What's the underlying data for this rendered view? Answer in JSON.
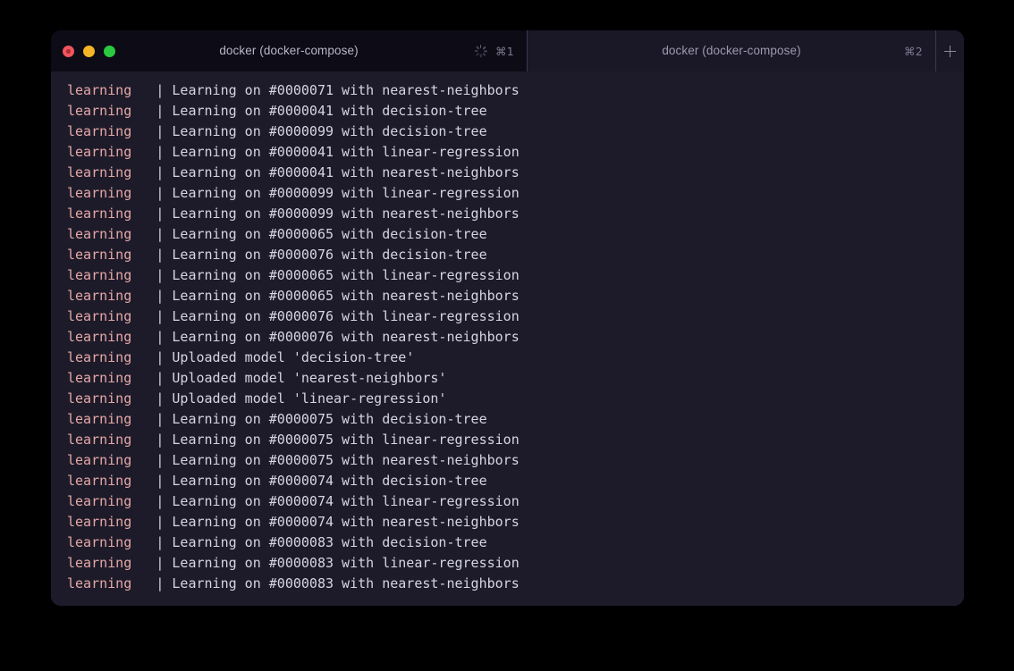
{
  "window": {
    "traffic_lights": [
      {
        "name": "close",
        "color": "#f0565c"
      },
      {
        "name": "minimize",
        "color": "#f5b526"
      },
      {
        "name": "maximize",
        "color": "#2ac940"
      }
    ],
    "tabs": [
      {
        "title": "docker (docker-compose)",
        "shortcut": "⌘1",
        "active": true,
        "busy": true,
        "busy_icon": "spinner-icon"
      },
      {
        "title": "docker (docker-compose)",
        "shortcut": "⌘2",
        "active": false,
        "busy": false
      }
    ],
    "new_tab_label": "+",
    "new_tab_icon": "plus-icon"
  },
  "terminal": {
    "service_label": "learning",
    "separator": "|",
    "lines": [
      {
        "service": "learning",
        "sep": "|",
        "message": "Learning on #0000071 with nearest-neighbors"
      },
      {
        "service": "learning",
        "sep": "|",
        "message": "Learning on #0000041 with decision-tree"
      },
      {
        "service": "learning",
        "sep": "|",
        "message": "Learning on #0000099 with decision-tree"
      },
      {
        "service": "learning",
        "sep": "|",
        "message": "Learning on #0000041 with linear-regression"
      },
      {
        "service": "learning",
        "sep": "|",
        "message": "Learning on #0000041 with nearest-neighbors"
      },
      {
        "service": "learning",
        "sep": "|",
        "message": "Learning on #0000099 with linear-regression"
      },
      {
        "service": "learning",
        "sep": "|",
        "message": "Learning on #0000099 with nearest-neighbors"
      },
      {
        "service": "learning",
        "sep": "|",
        "message": "Learning on #0000065 with decision-tree"
      },
      {
        "service": "learning",
        "sep": "|",
        "message": "Learning on #0000076 with decision-tree"
      },
      {
        "service": "learning",
        "sep": "|",
        "message": "Learning on #0000065 with linear-regression"
      },
      {
        "service": "learning",
        "sep": "|",
        "message": "Learning on #0000065 with nearest-neighbors"
      },
      {
        "service": "learning",
        "sep": "|",
        "message": "Learning on #0000076 with linear-regression"
      },
      {
        "service": "learning",
        "sep": "|",
        "message": "Learning on #0000076 with nearest-neighbors"
      },
      {
        "service": "learning",
        "sep": "|",
        "message": "Uploaded model 'decision-tree'"
      },
      {
        "service": "learning",
        "sep": "|",
        "message": "Uploaded model 'nearest-neighbors'"
      },
      {
        "service": "learning",
        "sep": "|",
        "message": "Uploaded model 'linear-regression'"
      },
      {
        "service": "learning",
        "sep": "|",
        "message": "Learning on #0000075 with decision-tree"
      },
      {
        "service": "learning",
        "sep": "|",
        "message": "Learning on #0000075 with linear-regression"
      },
      {
        "service": "learning",
        "sep": "|",
        "message": "Learning on #0000075 with nearest-neighbors"
      },
      {
        "service": "learning",
        "sep": "|",
        "message": "Learning on #0000074 with decision-tree"
      },
      {
        "service": "learning",
        "sep": "|",
        "message": "Learning on #0000074 with linear-regression"
      },
      {
        "service": "learning",
        "sep": "|",
        "message": "Learning on #0000074 with nearest-neighbors"
      },
      {
        "service": "learning",
        "sep": "|",
        "message": "Learning on #0000083 with decision-tree"
      },
      {
        "service": "learning",
        "sep": "|",
        "message": "Learning on #0000083 with linear-regression"
      },
      {
        "service": "learning",
        "sep": "|",
        "message": "Learning on #0000083 with nearest-neighbors"
      }
    ]
  },
  "colors": {
    "desktop_background": "#000000",
    "window_background": "#1d1b29",
    "active_tab_background": "#0d0b16",
    "inactive_tab_background": "#1a1827",
    "service_text": "#e6a8a8",
    "message_text": "#d6d5e4",
    "tab_title_text": "#9c9aae",
    "shortcut_text": "#7d7b90"
  }
}
